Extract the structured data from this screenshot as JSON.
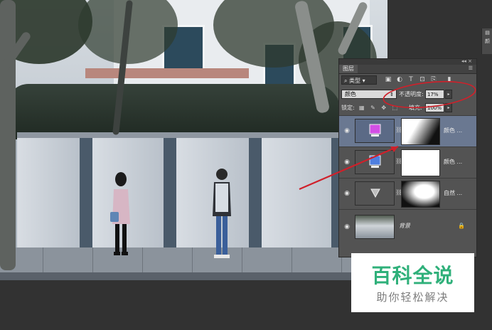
{
  "layers_panel": {
    "title": "图层",
    "filter_kind": "类型",
    "blend_mode": "颜色",
    "opacity_label": "不透明度:",
    "opacity_value": "17%",
    "lock_label": "锁定:",
    "fill_label": "填充:",
    "fill_value": "100%",
    "layers": [
      {
        "name": "颜色 ...",
        "selected": true,
        "swatch": "#d34fe6"
      },
      {
        "name": "颜色 ...",
        "selected": false,
        "swatch": "#4f7fe0"
      },
      {
        "name": "自然 ...",
        "selected": false
      },
      {
        "name": "背景",
        "selected": false,
        "locked": true
      }
    ]
  },
  "side_strip": {
    "label": "颜"
  },
  "watermark": {
    "title": "百科全说",
    "subtitle": "助你轻松解决",
    "color": "#2fb07a"
  },
  "annotation": {
    "color": "#d0202a"
  }
}
